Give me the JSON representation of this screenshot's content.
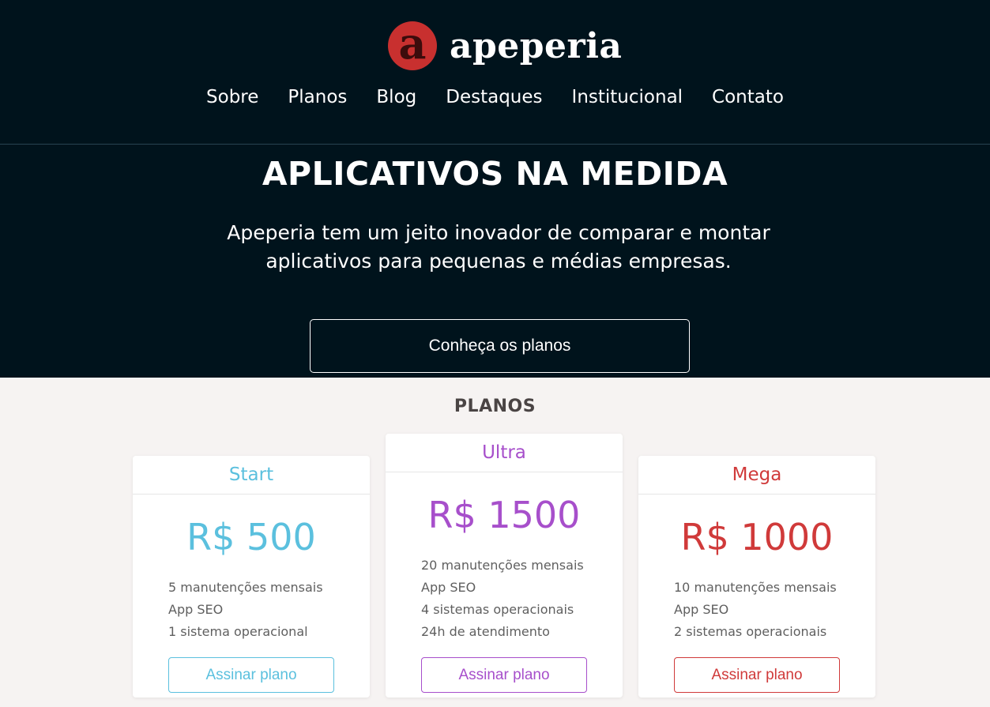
{
  "brand": {
    "logo_letter": "a",
    "name": "apeperia",
    "color": "#c8302f"
  },
  "nav": {
    "items": [
      "Sobre",
      "Planos",
      "Blog",
      "Destaques",
      "Institucional",
      "Contato"
    ]
  },
  "hero": {
    "title": "APLICATIVOS NA MEDIDA",
    "subtitle": "Apeperia tem um jeito inovador de comparar e montar aplicativos para pequenas e médias empresas.",
    "cta_label": "Conheça os planos"
  },
  "plans": {
    "section_title": "PLANOS",
    "cards": [
      {
        "name": "Start",
        "price": "R$ 500",
        "color": "#5bc0de",
        "features": [
          "5 manutenções mensais",
          "App SEO",
          "1 sistema operacional"
        ],
        "button_label": "Assinar plano"
      },
      {
        "name": "Ultra",
        "price": "R$ 1500",
        "color": "#a74fcb",
        "features": [
          "20 manutenções mensais",
          "App SEO",
          "4 sistemas operacionais",
          "24h de atendimento"
        ],
        "button_label": "Assinar plano"
      },
      {
        "name": "Mega",
        "price": "R$ 1000",
        "color": "#d03a3a",
        "features": [
          "10 manutenções mensais",
          "App SEO",
          "2 sistemas operacionais"
        ],
        "button_label": "Assinar plano"
      }
    ]
  }
}
